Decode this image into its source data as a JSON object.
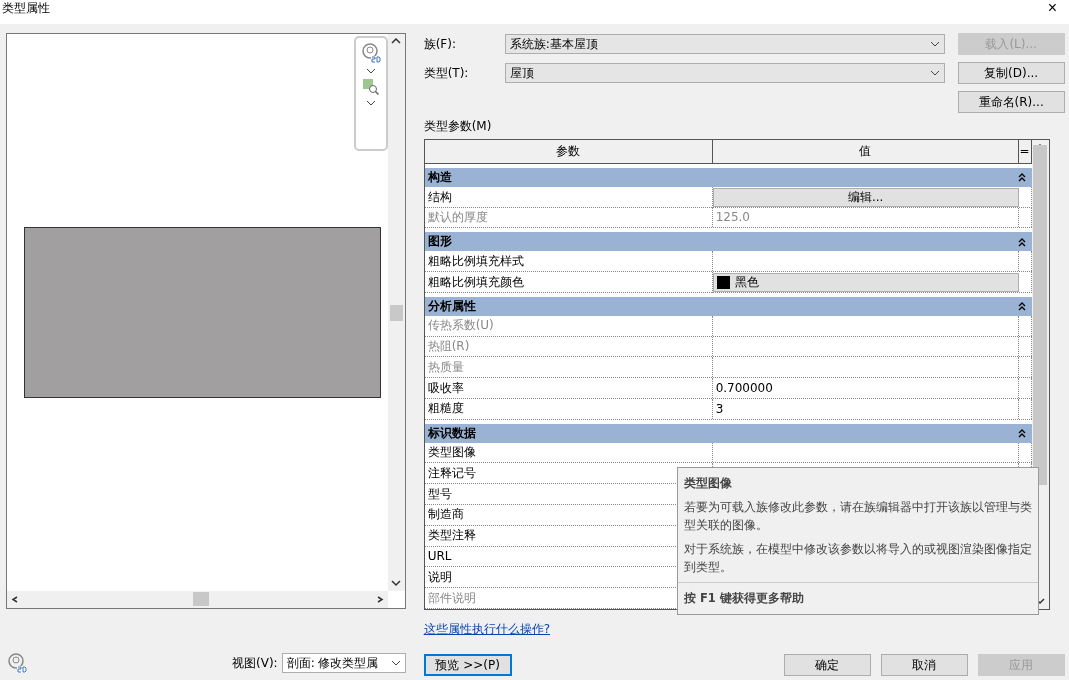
{
  "window": {
    "title": "类型属性",
    "close": "×"
  },
  "family": {
    "label": "族(F):",
    "value": "系统族:基本屋顶"
  },
  "type": {
    "label": "类型(T):",
    "value": "屋顶"
  },
  "side_buttons": [
    {
      "label": "载入(L)...",
      "disabled": true
    },
    {
      "label": "复制(D)...",
      "disabled": false
    },
    {
      "label": "重命名(R)...",
      "disabled": false
    }
  ],
  "params_label": "类型参数(M)",
  "table": {
    "columns": [
      "参数",
      "值",
      "="
    ],
    "rows": [
      {
        "kind": "group",
        "name": "构造",
        "expanded": true
      },
      {
        "kind": "button",
        "name": "结构",
        "disabled": false,
        "value": "编辑..."
      },
      {
        "kind": "param",
        "name": "默认的厚度",
        "disabled": true,
        "value": "125.0"
      },
      {
        "kind": "group",
        "name": "图形",
        "expanded": true
      },
      {
        "kind": "param",
        "name": "粗略比例填充样式",
        "disabled": false
      },
      {
        "kind": "swatch",
        "name": "粗略比例填充颜色",
        "disabled": false,
        "value": "黑色",
        "color": "#000000"
      },
      {
        "kind": "group",
        "name": "分析属性",
        "expanded": true
      },
      {
        "kind": "param",
        "name": "传热系数(U)",
        "disabled": true
      },
      {
        "kind": "param",
        "name": "热阻(R)",
        "disabled": true
      },
      {
        "kind": "param",
        "name": "热质量",
        "disabled": true
      },
      {
        "kind": "param",
        "name": "吸收率",
        "disabled": false,
        "value": "0.700000"
      },
      {
        "kind": "param",
        "name": "粗糙度",
        "disabled": false,
        "value": "3"
      },
      {
        "kind": "group",
        "name": "标识数据",
        "expanded": true
      },
      {
        "kind": "param",
        "name": "类型图像",
        "disabled": false
      },
      {
        "kind": "param",
        "name": "注释记号",
        "disabled": false
      },
      {
        "kind": "param",
        "name": "型号",
        "disabled": false
      },
      {
        "kind": "param",
        "name": "制造商",
        "disabled": false
      },
      {
        "kind": "param",
        "name": "类型注释",
        "disabled": false
      },
      {
        "kind": "param",
        "name": "URL",
        "disabled": false
      },
      {
        "kind": "param",
        "name": "说明",
        "disabled": false
      },
      {
        "kind": "param",
        "name": "部件说明",
        "disabled": true
      }
    ]
  },
  "tooltip": {
    "title": "类型图像",
    "paragraphs": [
      "若要为可载入族修改此参数，请在族编辑器中打开该族以管理与类型关联的图像。",
      "对于系统族，在模型中修改该参数以将导入的或视图渲染图像指定到类型。"
    ],
    "help": "按 F1 键获得更多帮助"
  },
  "help_link": "这些属性执行什么操作?",
  "view": {
    "label": "视图(V):",
    "value": "剖面: 修改类型属"
  },
  "preview_button": "预览 >>(P)",
  "buttons": [
    {
      "label": "确定",
      "disabled": false
    },
    {
      "label": "取消",
      "disabled": false
    },
    {
      "label": "应用",
      "disabled": true
    }
  ]
}
